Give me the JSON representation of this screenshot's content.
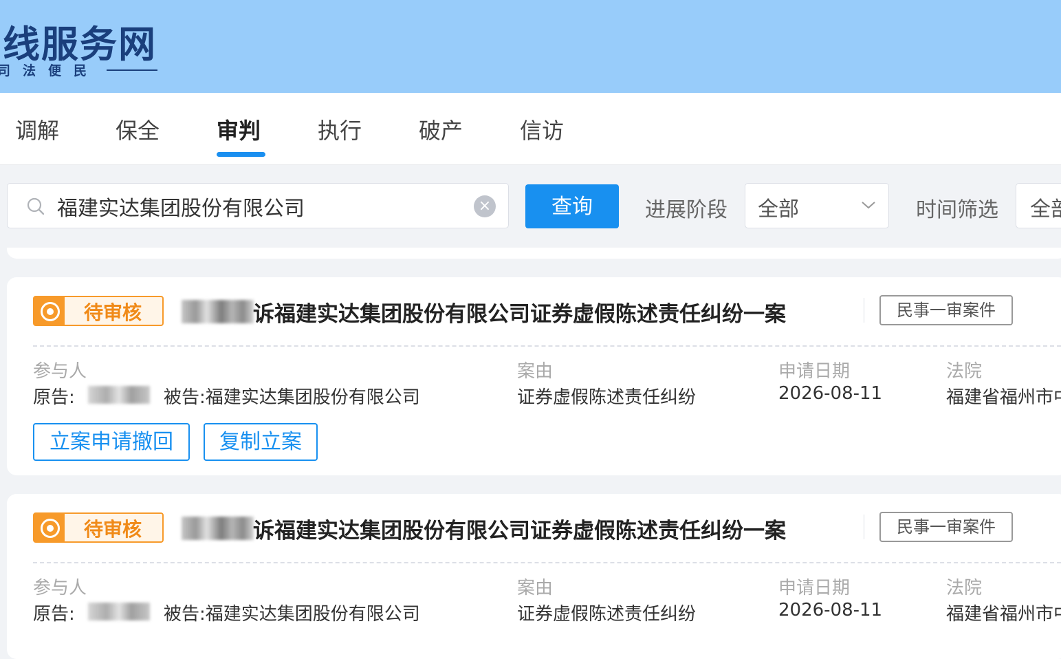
{
  "header": {
    "logo_title": "线服务网",
    "logo_subtitle": "司法便民"
  },
  "tabs": [
    {
      "label": "调解"
    },
    {
      "label": "保全"
    },
    {
      "label": "审判",
      "active": true
    },
    {
      "label": "执行"
    },
    {
      "label": "破产"
    },
    {
      "label": "信访"
    }
  ],
  "search": {
    "value": "福建实达集团股份有限公司",
    "query_label": "查询"
  },
  "filters": {
    "stage_label": "进展阶段",
    "stage_value": "全部",
    "time_label": "时间筛选",
    "time_value": "全部"
  },
  "cards": [
    {
      "status": "待审核",
      "title": "诉福建实达集团股份有限公司证券虚假陈述责任纠纷一案",
      "tag": "民事一审案件",
      "participants_label": "参与人",
      "plaintiff_label": "原告:",
      "defendant_text": "被告:福建实达集团股份有限公司",
      "cause_label": "案由",
      "cause_value": "证券虚假陈述责任纠纷",
      "date_label": "申请日期",
      "date_value": "2026-08-11",
      "court_label": "法院",
      "court_value": "福建省福州市中",
      "btn_withdraw": "立案申请撤回",
      "btn_copy": "复制立案"
    },
    {
      "status": "待审核",
      "title": "诉福建实达集团股份有限公司证券虚假陈述责任纠纷一案",
      "tag": "民事一审案件",
      "participants_label": "参与人",
      "plaintiff_label": "原告:",
      "defendant_text": "被告:福建实达集团股份有限公司",
      "cause_label": "案由",
      "cause_value": "证券虚假陈述责任纠纷",
      "date_label": "申请日期",
      "date_value": "2026-08-11",
      "court_label": "法院",
      "court_value": "福建省福州市中"
    }
  ],
  "colors": {
    "header_bg": "#98ccfa",
    "primary": "#1890f0",
    "status_orange": "#f79a2a"
  }
}
